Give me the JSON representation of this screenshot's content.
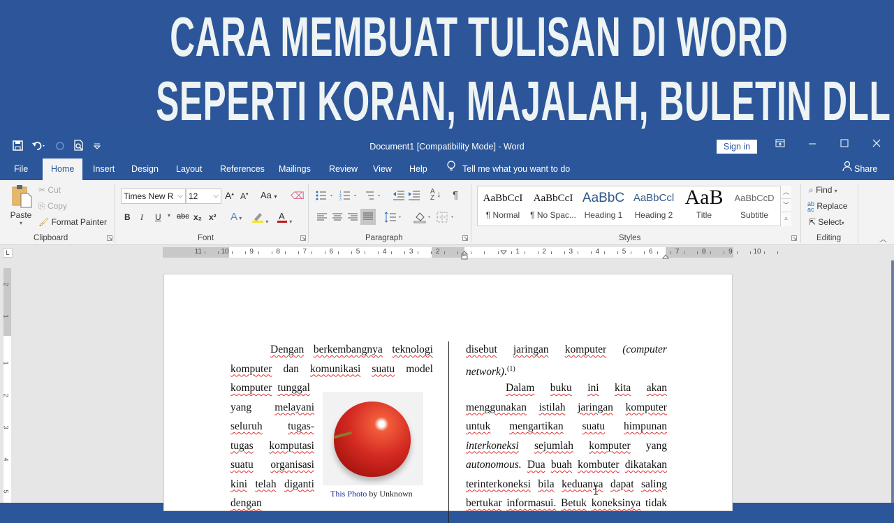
{
  "banner": {
    "line1": "CARA MEMBUAT TULISAN DI WORD",
    "line2": "SEPERTI KORAN, MAJALAH, BULETIN DLL"
  },
  "titlebar": {
    "title": "Document1 [Compatibility Mode]  -  Word",
    "sign_in": "Sign in",
    "icons": [
      "save-icon",
      "undo-icon",
      "redo-icon",
      "print-preview-icon",
      "customize-qat-icon",
      "ribbon-display-options-icon",
      "minimize-icon",
      "maximize-icon",
      "close-icon"
    ]
  },
  "tabs": [
    {
      "label": "File",
      "active": false
    },
    {
      "label": "Home",
      "active": true
    },
    {
      "label": "Insert",
      "active": false
    },
    {
      "label": "Design",
      "active": false
    },
    {
      "label": "Layout",
      "active": false
    },
    {
      "label": "References",
      "active": false
    },
    {
      "label": "Mailings",
      "active": false
    },
    {
      "label": "Review",
      "active": false
    },
    {
      "label": "View",
      "active": false
    },
    {
      "label": "Help",
      "active": false
    }
  ],
  "tell_me": "Tell me what you want to do",
  "share": "Share",
  "ribbon": {
    "clipboard": {
      "label": "Clipboard",
      "paste": "Paste",
      "cut": "Cut",
      "copy": "Copy",
      "format_painter": "Format Painter"
    },
    "font": {
      "label": "Font",
      "font_name": "Times New R",
      "font_size": "12",
      "bold": "B",
      "italic": "I",
      "underline": "U",
      "strike": "abc",
      "subscript": "x₂",
      "superscript": "x²",
      "change_case": "Aa"
    },
    "paragraph": {
      "label": "Paragraph"
    },
    "styles": {
      "label": "Styles",
      "items": [
        {
          "preview": "AaBbCcI",
          "name": "¶ Normal",
          "color": "#111111"
        },
        {
          "preview": "AaBbCcI",
          "name": "¶ No Spac...",
          "color": "#111111"
        },
        {
          "preview": "AaBbC",
          "name": "Heading 1",
          "color": "#2e5a8a"
        },
        {
          "preview": "AaBbCcl",
          "name": "Heading 2",
          "color": "#2e5a8a"
        },
        {
          "preview": "AaB",
          "name": "Title",
          "color": "#111111"
        },
        {
          "preview": "AaBbCcD",
          "name": "Subtitle",
          "color": "#666666"
        }
      ]
    },
    "editing": {
      "label": "Editing",
      "find": "Find",
      "replace": "Replace",
      "select": "Select"
    }
  },
  "ruler": {
    "numbers_left": [
      "11",
      "10",
      "9",
      "8",
      "7",
      "6",
      "5",
      "4",
      "3",
      "2"
    ],
    "numbers_right": [
      "1",
      "2",
      "3",
      "4",
      "5",
      "6",
      "7",
      "8",
      "9",
      "10"
    ],
    "vertical": [
      "2",
      "1",
      "1",
      "2",
      "3",
      "4",
      "5"
    ]
  },
  "document": {
    "left_column": [
      {
        "indent": true,
        "words": [
          {
            "t": "Dengan",
            "sq": true
          },
          {
            "t": "berkembangnya",
            "sq": true
          },
          {
            "t": "teknologi",
            "sq": true
          }
        ]
      },
      {
        "words": [
          {
            "t": "komputer",
            "sq": true
          },
          {
            "t": "dan"
          },
          {
            "t": "komunikasi",
            "sq": true
          },
          {
            "t": "suatu",
            "sq": true
          },
          {
            "t": "model"
          }
        ]
      },
      {
        "narrow": true,
        "left": true,
        "words": [
          {
            "t": "komputer",
            "sq": true
          },
          {
            "t": "tunggal",
            "sq": true
          }
        ]
      },
      {
        "narrow": true,
        "words": [
          {
            "t": "yang"
          },
          {
            "t": "melayani",
            "sq": true
          }
        ]
      },
      {
        "narrow": true,
        "words": [
          {
            "t": "seluruh",
            "sq": true
          },
          {
            "t": "tugas-",
            "sq": true
          }
        ]
      },
      {
        "narrow": true,
        "words": [
          {
            "t": "tugas",
            "sq": true
          },
          {
            "t": "komputasi",
            "sq": true
          }
        ]
      },
      {
        "narrow": true,
        "words": [
          {
            "t": "suatu",
            "sq": true
          },
          {
            "t": "organisasi",
            "sq": true
          }
        ]
      },
      {
        "narrow": true,
        "words": [
          {
            "t": "kini",
            "sq": true
          },
          {
            "t": "telah",
            "sq": true
          },
          {
            "t": "diganti",
            "sq": true
          }
        ]
      },
      {
        "narrow": true,
        "left": true,
        "words": [
          {
            "t": "dengan",
            "sq": true
          }
        ]
      }
    ],
    "right_column": [
      {
        "words": [
          {
            "t": "disebut",
            "sq": true
          },
          {
            "t": "jaringan",
            "sq": true
          },
          {
            "t": "komputer",
            "sq": true
          },
          {
            "t": "(computer",
            "it": true
          }
        ]
      },
      {
        "left": true,
        "words": [
          {
            "t": "network).",
            "it": true,
            "sup": "(1)"
          }
        ]
      },
      {
        "indent": true,
        "words": [
          {
            "t": "Dalam",
            "sq": true
          },
          {
            "t": "buku",
            "sq": true
          },
          {
            "t": "ini",
            "sq": true
          },
          {
            "t": "kita",
            "sq": true
          },
          {
            "t": "akan",
            "sq": true
          }
        ]
      },
      {
        "words": [
          {
            "t": "menggunakan",
            "sq": true
          },
          {
            "t": "istilah",
            "sq": true
          },
          {
            "t": "jaringan",
            "sq": true
          },
          {
            "t": "komputer",
            "sq": true
          }
        ]
      },
      {
        "words": [
          {
            "t": "untuk",
            "sq": true
          },
          {
            "t": "mengartikan",
            "sq": true
          },
          {
            "t": "suatu",
            "sq": true
          },
          {
            "t": "himpunan",
            "sq": true
          }
        ]
      },
      {
        "words": [
          {
            "t": "interkoneksi",
            "sq": true,
            "it": true
          },
          {
            "t": "sejumlah",
            "sq": true
          },
          {
            "t": "komputer",
            "sq": true
          },
          {
            "t": "yang"
          }
        ]
      },
      {
        "words": [
          {
            "t": "autonomous.",
            "it": true
          },
          {
            "t": "Dua",
            "sq": true
          },
          {
            "t": "buah",
            "sq": true
          },
          {
            "t": "kombuter",
            "sq": true
          },
          {
            "t": "dikatakan",
            "sq": true
          }
        ]
      },
      {
        "words": [
          {
            "t": "terinterkoneksi",
            "sq": true
          },
          {
            "t": "bila",
            "sq": true
          },
          {
            "t": "keduanya",
            "sq": true
          },
          {
            "t": "dapat",
            "sq": true
          },
          {
            "t": "saling",
            "sq": true
          }
        ]
      },
      {
        "words": [
          {
            "t": "bertukar",
            "sq": true
          },
          {
            "t": "informasui.",
            "sq": true
          },
          {
            "t": "Betuk",
            "sq": true
          },
          {
            "t": "koneksinya",
            "sq": true
          },
          {
            "t": "tidak"
          }
        ]
      }
    ],
    "image_caption": {
      "link": "This Photo",
      "rest": " by Unknown"
    },
    "image_alt": "apple-photo"
  }
}
